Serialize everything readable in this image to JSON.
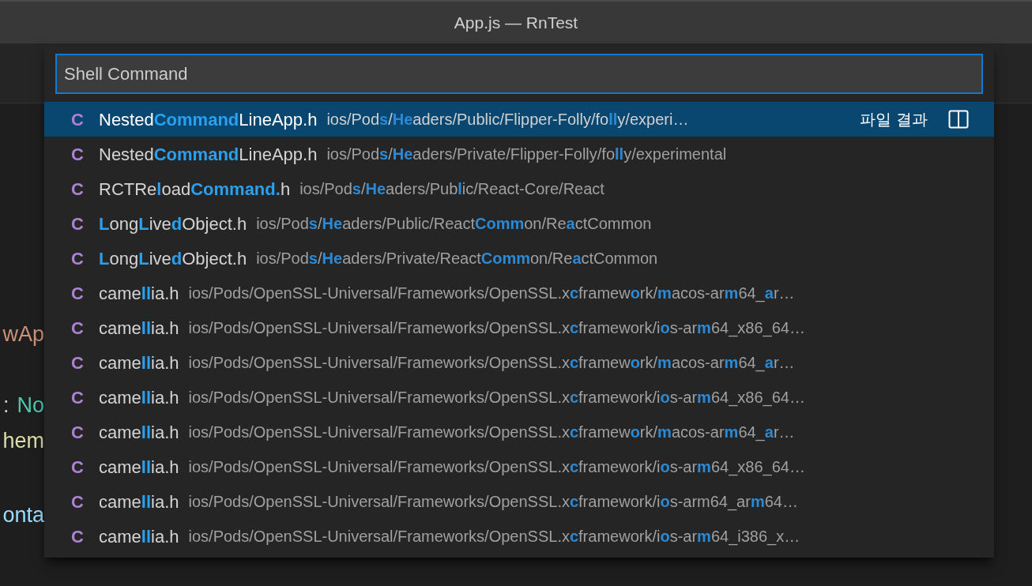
{
  "window": {
    "title": "App.js — RnTest"
  },
  "editor_fragments": [
    {
      "text": "wAp",
      "color": "#ce9178"
    },
    {
      "text": ":",
      "color": "#d4d4d4"
    },
    {
      "text": "No",
      "color": "#4ec9b0"
    },
    {
      "text": "hem",
      "color": "#dcdcaa"
    },
    {
      "text": "onta",
      "color": "#9cdcfe"
    }
  ],
  "quick_open": {
    "input": {
      "value": "Shell Command"
    },
    "rows": [
      {
        "icon": "C",
        "name": "Nested**Command**LineApp.h",
        "path": "ios/Pod**s**/**He**aders/Public/Flipper-Folly/fo**ll**y/experi…",
        "selected": true,
        "label": "파일 결과"
      },
      {
        "icon": "C",
        "name": "Nested**Command**LineApp.h",
        "path": "ios/Pod**s**/**He**aders/Private/Flipper-Folly/fo**ll**y/experimental",
        "selected": false
      },
      {
        "icon": "C",
        "name": "RCTRe**l**oad**Command.**h",
        "path": "ios/Pod**s**/**He**aders/Pub**l**ic/React-Core/React",
        "selected": false
      },
      {
        "icon": "C",
        "name": "**L**ong**L**ive**d**Object.h",
        "path": "ios/Pod**s**/**He**aders/Public/React**Comm**on/Re**a**ctCommon",
        "selected": false
      },
      {
        "icon": "C",
        "name": "**L**ong**L**ive**d**Object.h",
        "path": "ios/Pod**s**/**He**aders/Private/React**Comm**on/Re**a**ctCommon",
        "selected": false
      },
      {
        "icon": "C",
        "name": "came**ll**ia.h",
        "path": "ios/Pods/OpenSSL-Universal/Frameworks/OpenSSL.x**c**framew**o**rk/**m**acos-ar**m**64_**a**r…",
        "selected": false
      },
      {
        "icon": "C",
        "name": "came**ll**ia.h",
        "path": "ios/Pods/OpenSSL-Universal/Frameworks/OpenSSL.x**c**framework/i**o**s-ar**m**64_x86_64…",
        "selected": false
      },
      {
        "icon": "C",
        "name": "came**ll**ia.h",
        "path": "ios/Pods/OpenSSL-Universal/Frameworks/OpenSSL.x**c**framew**o**rk/**m**acos-ar**m**64_**a**r…",
        "selected": false
      },
      {
        "icon": "C",
        "name": "came**ll**ia.h",
        "path": "ios/Pods/OpenSSL-Universal/Frameworks/OpenSSL.x**c**framework/i**o**s-ar**m**64_x86_64…",
        "selected": false
      },
      {
        "icon": "C",
        "name": "came**ll**ia.h",
        "path": "ios/Pods/OpenSSL-Universal/Frameworks/OpenSSL.x**c**framew**o**rk/**m**acos-ar**m**64_**a**r…",
        "selected": false
      },
      {
        "icon": "C",
        "name": "came**ll**ia.h",
        "path": "ios/Pods/OpenSSL-Universal/Frameworks/OpenSSL.x**c**framework/i**o**s-ar**m**64_x86_64…",
        "selected": false
      },
      {
        "icon": "C",
        "name": "came**ll**ia.h",
        "path": "ios/Pods/OpenSSL-Universal/Frameworks/OpenSSL.x**c**framework/i**o**s-arm64_ar**m**64…",
        "selected": false
      },
      {
        "icon": "C",
        "name": "came**ll**ia.h",
        "path": "ios/Pods/OpenSSL-Universal/Frameworks/OpenSSL.x**c**framework/i**o**s-ar**m**64_i386_x…",
        "selected": false
      }
    ]
  }
}
